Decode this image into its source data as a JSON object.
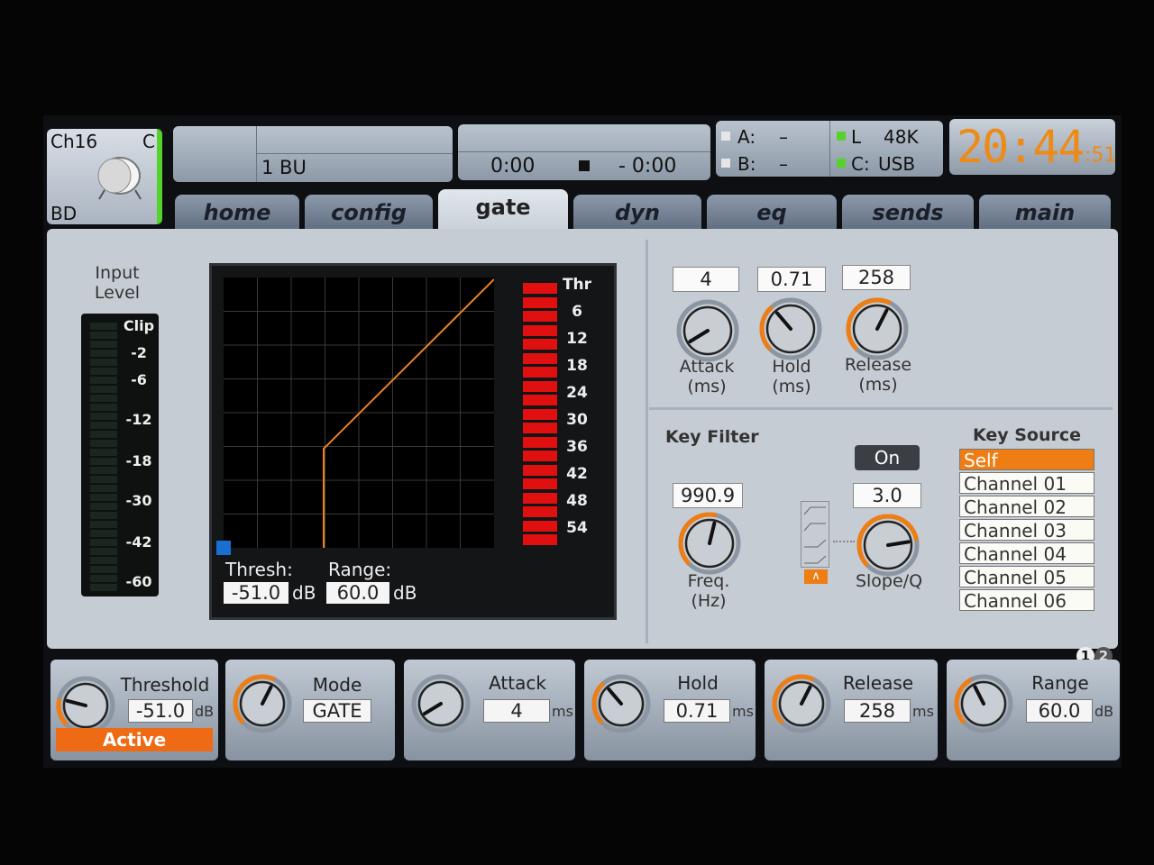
{
  "channel": {
    "name": "Ch16",
    "side": "C",
    "label": "BD"
  },
  "header": {
    "bus": "1 BU",
    "play_time": "0:00",
    "remaining": "- 0:00",
    "a_label": "A:",
    "a_val": "–",
    "b_label": "B:",
    "b_val": "–",
    "l_label": "L",
    "rate": "48K",
    "c_label": "C:",
    "usb": "USB",
    "clock": "20:44",
    "clock_sec": ":51"
  },
  "tabs": [
    "home",
    "config",
    "gate",
    "dyn",
    "eq",
    "sends",
    "main"
  ],
  "active_tab": "gate",
  "meter": {
    "title1": "Input",
    "title2": "Level",
    "ticks": [
      "Clip",
      "-2",
      "-6",
      "-12",
      "-18",
      "-30",
      "-42",
      "-60"
    ]
  },
  "graph": {
    "ticks": [
      "Thr",
      "6",
      "12",
      "18",
      "24",
      "30",
      "36",
      "42",
      "48",
      "54"
    ],
    "thresh_label": "Thresh:",
    "thresh_val": "-51.0",
    "thresh_unit": "dB",
    "range_label": "Range:",
    "range_val": "60.0",
    "range_unit": "dB"
  },
  "timing": {
    "attack_val": "4",
    "attack_l1": "Attack",
    "attack_l2": "(ms)",
    "hold_val": "0.71",
    "hold_l1": "Hold",
    "hold_l2": "(ms)",
    "release_val": "258",
    "release_l1": "Release",
    "release_l2": "(ms)"
  },
  "keyfilter": {
    "title": "Key Filter",
    "on": "On",
    "freq_val": "990.9",
    "freq_l1": "Freq.",
    "freq_l2": "(Hz)",
    "slope_val": "3.0",
    "slope_label": "Slope/Q"
  },
  "keysource": {
    "title": "Key Source",
    "items": [
      "Self",
      "Channel 01",
      "Channel 02",
      "Channel 03",
      "Channel 04",
      "Channel 05",
      "Channel 06"
    ],
    "selected": "Self"
  },
  "bottom": {
    "page": "1",
    "page2": "2",
    "threshold": {
      "name": "Threshold",
      "val": "-51.0",
      "unit": "dB",
      "status": "Active"
    },
    "mode": {
      "name": "Mode",
      "val": "GATE"
    },
    "attack": {
      "name": "Attack",
      "val": "4",
      "unit": "ms"
    },
    "hold": {
      "name": "Hold",
      "val": "0.71",
      "unit": "ms"
    },
    "release": {
      "name": "Release",
      "val": "258",
      "unit": "ms"
    },
    "range": {
      "name": "Range",
      "val": "60.0",
      "unit": "dB"
    }
  },
  "colors": {
    "accent": "#ee7d14",
    "meter_red": "#e01010",
    "status_green": "#55d22b",
    "graph_line": "#f08020"
  }
}
